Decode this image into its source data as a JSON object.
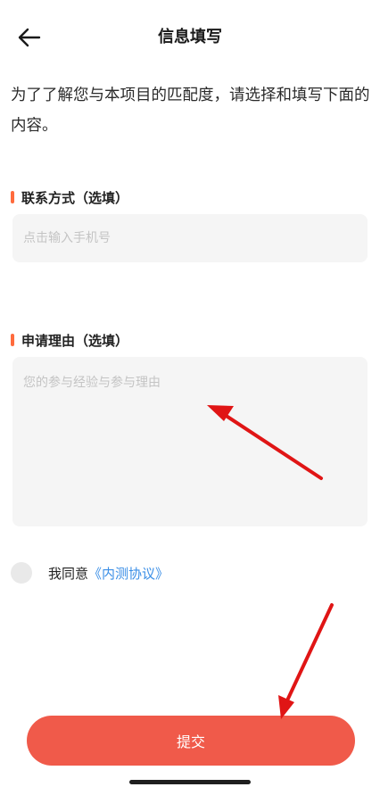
{
  "header": {
    "back_icon": "arrow-left-icon",
    "title": "信息填写"
  },
  "intro": {
    "text": "为了了解您与本项目的匹配度，请选择和填写下面的内容。"
  },
  "contact": {
    "label": "联系方式（选填）",
    "placeholder": "点击输入手机号",
    "value": ""
  },
  "reason": {
    "label": "申请理由（选填）",
    "placeholder": "您的参与经验与参与理由",
    "value": ""
  },
  "agreement": {
    "checked": false,
    "prefix": "我同意",
    "link_text": "《内测协议》"
  },
  "submit": {
    "label": "提交"
  },
  "colors": {
    "accent": "#ff6b3d",
    "submit_bg": "#f05a4a",
    "link": "#3a8ee6",
    "input_bg": "#f5f5f5",
    "annotation_arrow": "#e01515"
  }
}
